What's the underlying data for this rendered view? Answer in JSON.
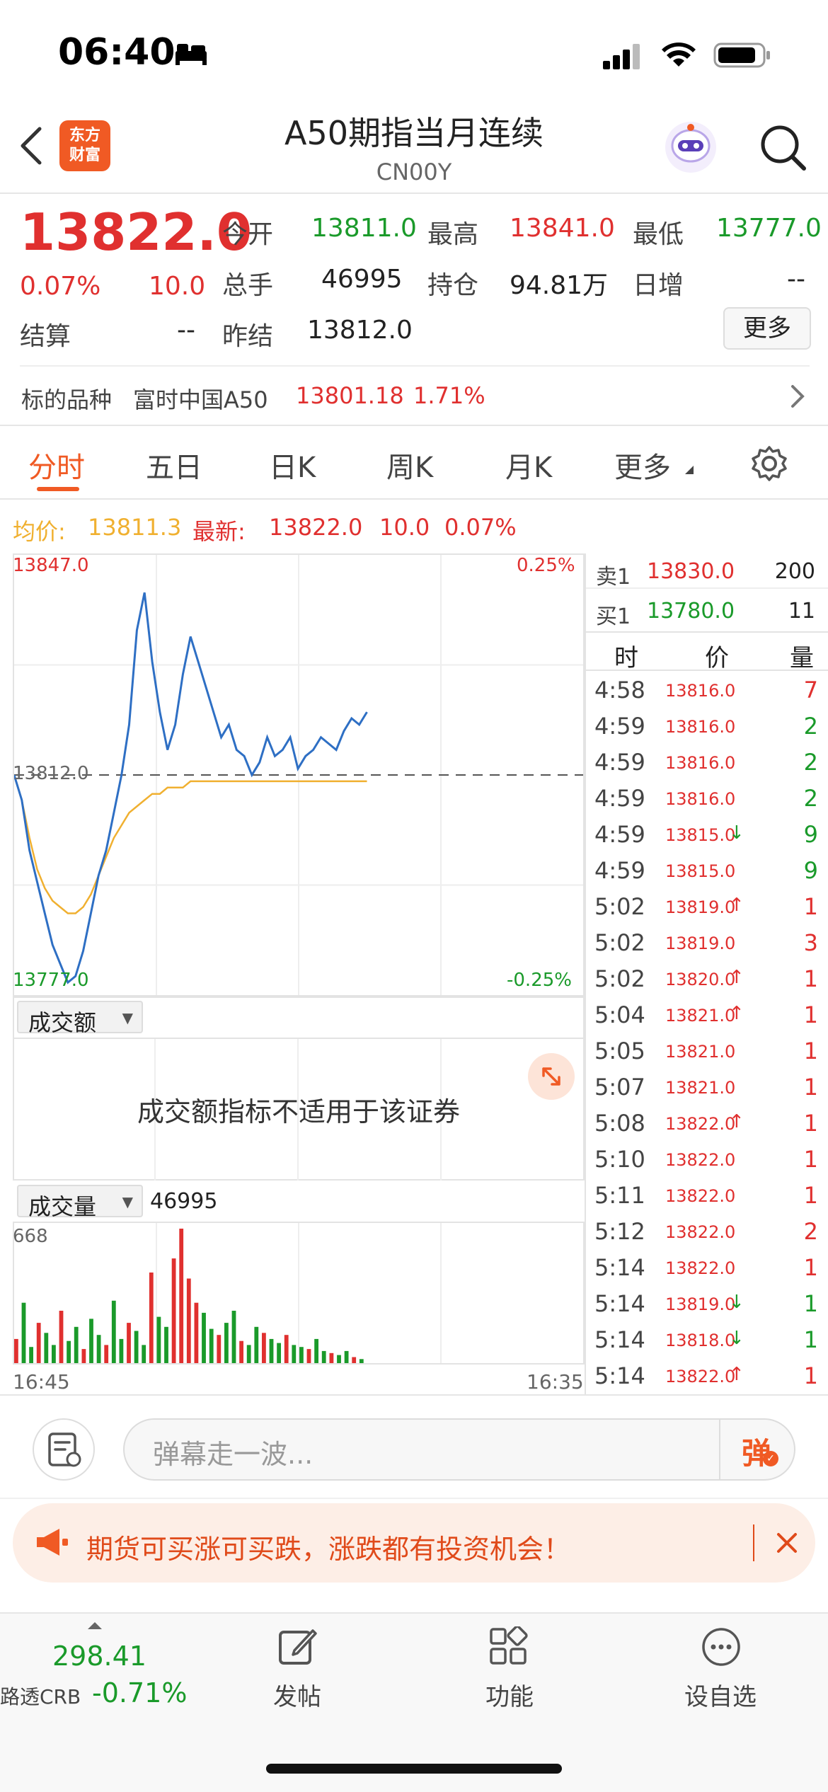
{
  "status_bar": {
    "time": "06:40"
  },
  "nav": {
    "logo_text_line1": "东方",
    "logo_text_line2": "财富",
    "title": "A50期指当月连续",
    "subtitle": "CN00Y"
  },
  "quote": {
    "last_price": "13822.0",
    "change_pct": "0.07%",
    "change": "10.0",
    "open_label": "今开",
    "open": "13811.0",
    "high_label": "最高",
    "high": "13841.0",
    "low_label": "最低",
    "low": "13777.0",
    "volume_label": "总手",
    "volume": "46995",
    "oi_label": "持仓",
    "oi": "94.81万",
    "daily_inc_label": "日增",
    "daily_inc": "--",
    "settle_label": "结算",
    "settle": "--",
    "prev_settle_label": "昨结",
    "prev_settle": "13812.0",
    "more_button": "更多"
  },
  "underlying": {
    "label": "标的品种",
    "name": "富时中国A50",
    "price": "13801.18",
    "pct": "1.71%"
  },
  "tabs": [
    "分时",
    "五日",
    "日K",
    "周K",
    "月K",
    "更多"
  ],
  "chart_header": {
    "avg_label": "均价:",
    "avg": "13811.3",
    "latest_label": "最新:",
    "latest": "13822.0",
    "chg": "10.0",
    "pct": "0.07%"
  },
  "chart_data": [
    {
      "type": "line",
      "y_top": "13847.0",
      "y_mid": "13812.0",
      "y_bottom": "13777.0",
      "pct_top": "0.25%",
      "pct_bottom": "-0.25%",
      "ylim": [
        13777.0,
        13847.0
      ],
      "series": [
        {
          "name": "price",
          "color": "#2e6fc4",
          "values": [
            13812,
            13808,
            13800,
            13795,
            13790,
            13785,
            13782,
            13779,
            13780,
            13784,
            13790,
            13796,
            13800,
            13806,
            13812,
            13820,
            13835,
            13841,
            13830,
            13822,
            13816,
            13820,
            13828,
            13834,
            13830,
            13826,
            13822,
            13818,
            13820,
            13816,
            13815,
            13812,
            13814,
            13818,
            13815,
            13816,
            13818,
            13813,
            13815,
            13816,
            13818,
            13817,
            13816,
            13819,
            13821,
            13820,
            13822
          ]
        },
        {
          "name": "avg",
          "color": "#f0b030",
          "values": [
            13812,
            13808,
            13802,
            13797,
            13794,
            13792,
            13791,
            13790,
            13790,
            13791,
            13793,
            13796,
            13799,
            13802,
            13804,
            13806,
            13807,
            13808,
            13809,
            13809,
            13810,
            13810,
            13810,
            13811,
            13811,
            13811,
            13811,
            13811,
            13811,
            13811,
            13811,
            13811,
            13811,
            13811,
            13811,
            13811,
            13811,
            13811,
            13811,
            13811,
            13811,
            13811,
            13811,
            13811,
            13811,
            13811,
            13811
          ]
        }
      ]
    },
    {
      "type": "bar",
      "ymax_label": "668",
      "ylim": [
        0,
        668
      ],
      "values": [
        120,
        300,
        80,
        200,
        150,
        90,
        260,
        110,
        180,
        70,
        220,
        140,
        90,
        310,
        120,
        200,
        160,
        90,
        450,
        230,
        180,
        520,
        668,
        420,
        300,
        250,
        170,
        140,
        200,
        260,
        110,
        90,
        180,
        150,
        120,
        100,
        140,
        90,
        80,
        70,
        120,
        60,
        50,
        40,
        60,
        30,
        20
      ]
    }
  ],
  "amount_panel": {
    "dropdown": "成交额",
    "message": "成交额指标不适用于该证券"
  },
  "volume_panel": {
    "dropdown": "成交量",
    "value": "46995",
    "time_start": "16:45",
    "time_end": "16:35"
  },
  "order_book": {
    "ask": {
      "label": "卖1",
      "price": "13830.0",
      "vol": "200"
    },
    "bid": {
      "label": "买1",
      "price": "13780.0",
      "vol": "11"
    },
    "headers": [
      "时",
      "价",
      "量"
    ]
  },
  "ticks": [
    {
      "time": "4:58",
      "price": "13816.0",
      "arrow": "",
      "vol": "7",
      "vol_color": "red"
    },
    {
      "time": "4:59",
      "price": "13816.0",
      "arrow": "",
      "vol": "2",
      "vol_color": "green"
    },
    {
      "time": "4:59",
      "price": "13816.0",
      "arrow": "",
      "vol": "2",
      "vol_color": "green"
    },
    {
      "time": "4:59",
      "price": "13816.0",
      "arrow": "",
      "vol": "2",
      "vol_color": "green"
    },
    {
      "time": "4:59",
      "price": "13815.0",
      "arrow": "down",
      "vol": "9",
      "vol_color": "green"
    },
    {
      "time": "4:59",
      "price": "13815.0",
      "arrow": "",
      "vol": "9",
      "vol_color": "green"
    },
    {
      "time": "5:02",
      "price": "13819.0",
      "arrow": "up",
      "vol": "1",
      "vol_color": "red"
    },
    {
      "time": "5:02",
      "price": "13819.0",
      "arrow": "",
      "vol": "3",
      "vol_color": "red"
    },
    {
      "time": "5:02",
      "price": "13820.0",
      "arrow": "up",
      "vol": "1",
      "vol_color": "red"
    },
    {
      "time": "5:04",
      "price": "13821.0",
      "arrow": "up",
      "vol": "1",
      "vol_color": "red"
    },
    {
      "time": "5:05",
      "price": "13821.0",
      "arrow": "",
      "vol": "1",
      "vol_color": "red"
    },
    {
      "time": "5:07",
      "price": "13821.0",
      "arrow": "",
      "vol": "1",
      "vol_color": "red"
    },
    {
      "time": "5:08",
      "price": "13822.0",
      "arrow": "up",
      "vol": "1",
      "vol_color": "red"
    },
    {
      "time": "5:10",
      "price": "13822.0",
      "arrow": "",
      "vol": "1",
      "vol_color": "red"
    },
    {
      "time": "5:11",
      "price": "13822.0",
      "arrow": "",
      "vol": "1",
      "vol_color": "red"
    },
    {
      "time": "5:12",
      "price": "13822.0",
      "arrow": "",
      "vol": "2",
      "vol_color": "red"
    },
    {
      "time": "5:14",
      "price": "13822.0",
      "arrow": "",
      "vol": "1",
      "vol_color": "red"
    },
    {
      "time": "5:14",
      "price": "13819.0",
      "arrow": "down",
      "vol": "1",
      "vol_color": "green"
    },
    {
      "time": "5:14",
      "price": "13818.0",
      "arrow": "down",
      "vol": "1",
      "vol_color": "green"
    },
    {
      "time": "5:14",
      "price": "13822.0",
      "arrow": "up",
      "vol": "1",
      "vol_color": "red"
    }
  ],
  "comment_bar": {
    "placeholder": "弹幕走一波...",
    "danmaku_button": "弹"
  },
  "banner": {
    "text": "期货可买涨可买跌，涨跌都有投资机会！"
  },
  "bottom_bar": {
    "index_value": "298.41",
    "index_name": "路透CRB",
    "index_pct": "-0.71%",
    "post": "发帖",
    "functions": "功能",
    "watchlist": "设自选"
  }
}
